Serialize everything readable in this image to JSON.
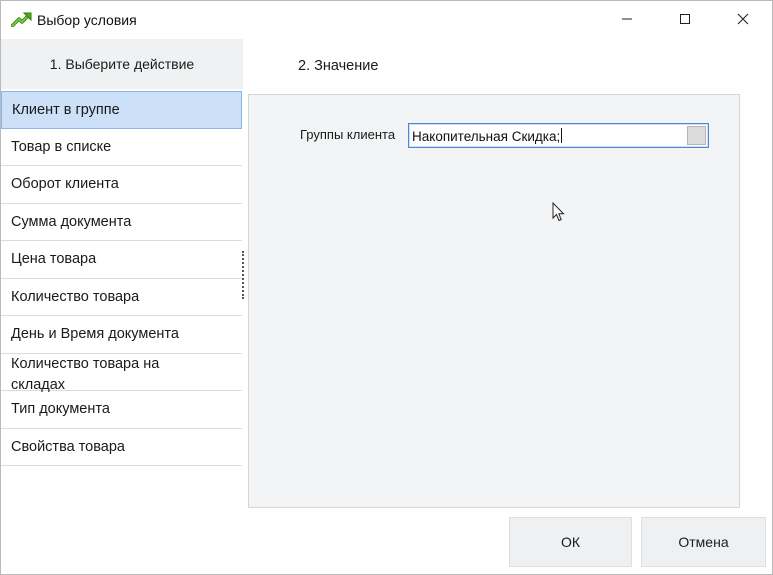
{
  "window": {
    "title": "Выбор условия",
    "icon": "green-arrow-icon",
    "controls": [
      "minimize-icon",
      "maximize-icon",
      "close-icon"
    ]
  },
  "left_panel": {
    "header": "1. Выберите  действие",
    "items": [
      {
        "label": "Клиент в группе",
        "selected": true
      },
      {
        "label": "Товар в списке",
        "selected": false
      },
      {
        "label": "Оборот клиента",
        "selected": false
      },
      {
        "label": "Сумма документа",
        "selected": false
      },
      {
        "label": "Цена товара",
        "selected": false
      },
      {
        "label": "Количество товара",
        "selected": false
      },
      {
        "label": "День и Время документа",
        "selected": false
      },
      {
        "label": "Количество товара на складах",
        "selected": false
      },
      {
        "label": "Тип документа",
        "selected": false
      },
      {
        "label": "Свойства товара",
        "selected": false
      }
    ]
  },
  "right_panel": {
    "title": "2. Значение",
    "field_label": "Группы клиента",
    "field_value": "Накопительная Скидка;"
  },
  "buttons": {
    "ok": "ОК",
    "cancel": "Отмена"
  },
  "colors": {
    "selection_bg": "#cce0f7",
    "selection_border": "#8cb6e6",
    "input_focus_border": "#4a8ad4",
    "icon_green": "#4caf1a"
  }
}
